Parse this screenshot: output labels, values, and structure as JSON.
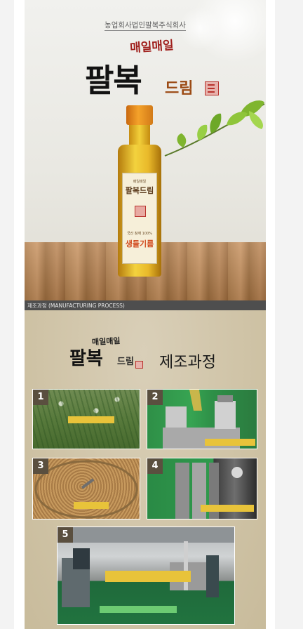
{
  "hero": {
    "company": "농업회사법인팔복주식회사",
    "brand_top": "매일매일",
    "brand_main": "팔복",
    "brand_sub": "드림",
    "bottle_label": {
      "line1": "매일매일",
      "line2": "팔복드림",
      "line3": "국산 참깨 100%",
      "line4": "생들기름"
    }
  },
  "section_bar": {
    "label": "제조과정 (MANUFACTURING PROCESS)"
  },
  "process": {
    "brand_top": "매일매일",
    "brand_main": "팔복",
    "brand_sub": "드림",
    "title": "제조과정",
    "steps": [
      {
        "num": "1"
      },
      {
        "num": "2"
      },
      {
        "num": "3"
      },
      {
        "num": "4"
      },
      {
        "num": "5"
      }
    ]
  },
  "colors": {
    "accent_red": "#a0201d",
    "bar": "#4e4e4e",
    "caption_yellow": "#e8c33a",
    "process_bg": "#cfc3a6"
  }
}
